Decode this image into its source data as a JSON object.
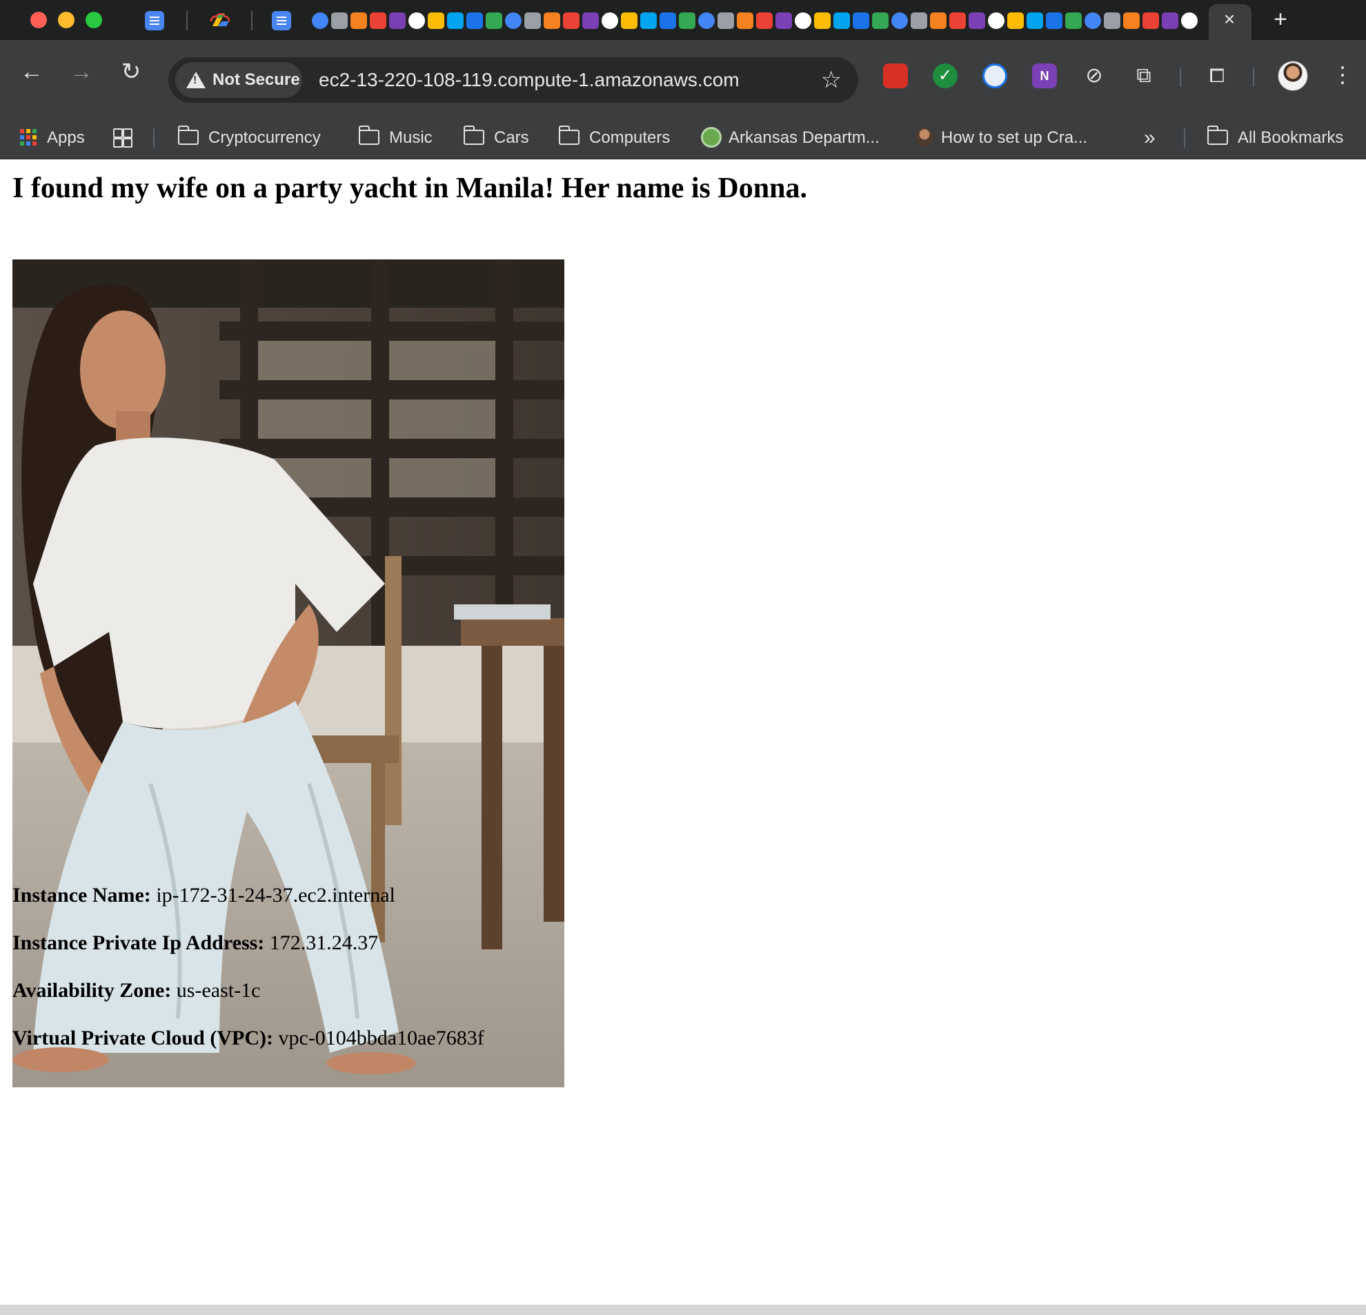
{
  "browser": {
    "tab": {
      "close_icon": "×"
    },
    "new_tab_icon": "+",
    "toolbar": {
      "back_icon": "←",
      "forward_icon": "→",
      "reload_icon": "↻",
      "security_label": "Not Secure",
      "url": "ec2-13-220-108-119.compute-1.amazonaws.com",
      "bookmark_star_icon": "☆",
      "menu_icon": "⋮"
    },
    "bookmarks_bar": {
      "apps_label": "Apps",
      "items": [
        {
          "label": "Cryptocurrency",
          "icon": "folder-icon"
        },
        {
          "label": "Music",
          "icon": "folder-icon"
        },
        {
          "label": "Cars",
          "icon": "folder-icon"
        },
        {
          "label": "Computers",
          "icon": "folder-icon"
        },
        {
          "label": "Arkansas Departm...",
          "icon": "site-favicon"
        },
        {
          "label": "How to set up Cra...",
          "icon": "person-favicon"
        }
      ],
      "overflow_icon": "»",
      "all_bookmarks_label": "All Bookmarks"
    }
  },
  "page": {
    "headline": "I found my wife on a party yacht in Manila! Her name is Donna.",
    "info": [
      {
        "label": "Instance Name:",
        "value": "ip-172-31-24-37.ec2.internal"
      },
      {
        "label": "Instance Private Ip Address:",
        "value": "172.31.24.37"
      },
      {
        "label": "Availability Zone:",
        "value": "us-east-1c"
      },
      {
        "label": "Virtual Private Cloud (VPC):",
        "value": "vpc-0104bbda10ae7683f"
      }
    ]
  },
  "colors": {
    "chrome_dark": "#1f2020",
    "toolbar": "#3b3d3f",
    "omnibox": "#282828",
    "page_background": "#ffffff"
  }
}
